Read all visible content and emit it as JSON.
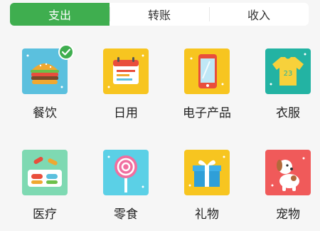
{
  "tabs": [
    {
      "label": "支出",
      "active": true
    },
    {
      "label": "转账",
      "active": false
    },
    {
      "label": "收入",
      "active": false
    }
  ],
  "categories": [
    {
      "label": "餐饮",
      "icon": "burger-icon",
      "bg": "#5bc0de",
      "selected": true
    },
    {
      "label": "日用",
      "icon": "calendar-icon",
      "bg": "#f7c520",
      "selected": false
    },
    {
      "label": "电子产品",
      "icon": "phone-icon",
      "bg": "#f7c520",
      "selected": false
    },
    {
      "label": "衣服",
      "icon": "shirt-icon",
      "bg": "#23b3a3",
      "selected": false
    },
    {
      "label": "医疗",
      "icon": "pills-icon",
      "bg": "#7ed9b2",
      "selected": false
    },
    {
      "label": "零食",
      "icon": "lollipop-icon",
      "bg": "#5bd0e6",
      "selected": false
    },
    {
      "label": "礼物",
      "icon": "gift-icon",
      "bg": "#f7c520",
      "selected": false
    },
    {
      "label": "宠物",
      "icon": "dog-icon",
      "bg": "#f05a5a",
      "selected": false
    }
  ],
  "colors": {
    "accent": "#3fae4f"
  }
}
